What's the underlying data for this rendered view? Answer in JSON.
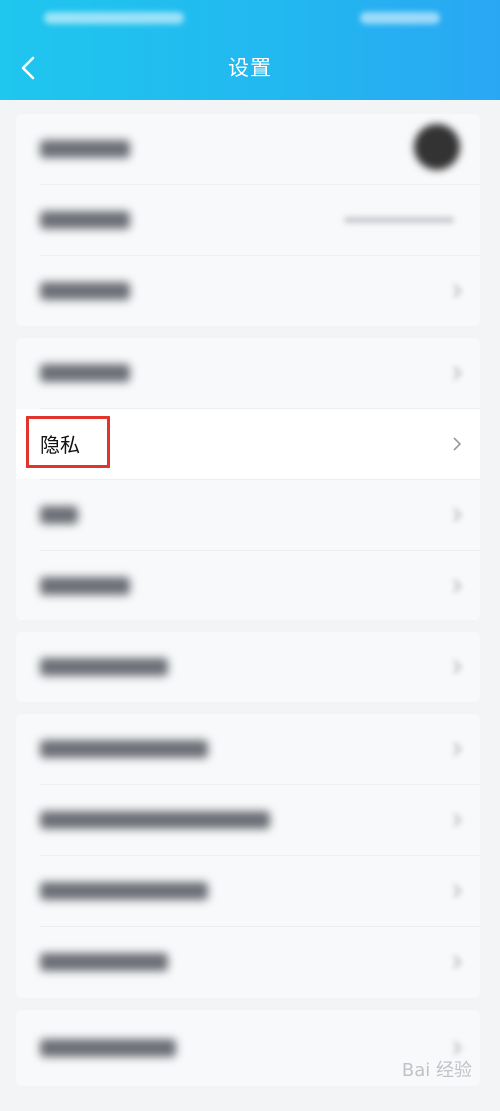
{
  "header": {
    "title": "设置",
    "back_icon": "chevron-left-icon"
  },
  "settings": {
    "privacy_label": "隐私"
  },
  "watermark": {
    "text": "Bai 经验"
  },
  "colors": {
    "header_start": "#1fc6ee",
    "header_end": "#2aa7f3",
    "highlight_border": "#e0342c"
  }
}
